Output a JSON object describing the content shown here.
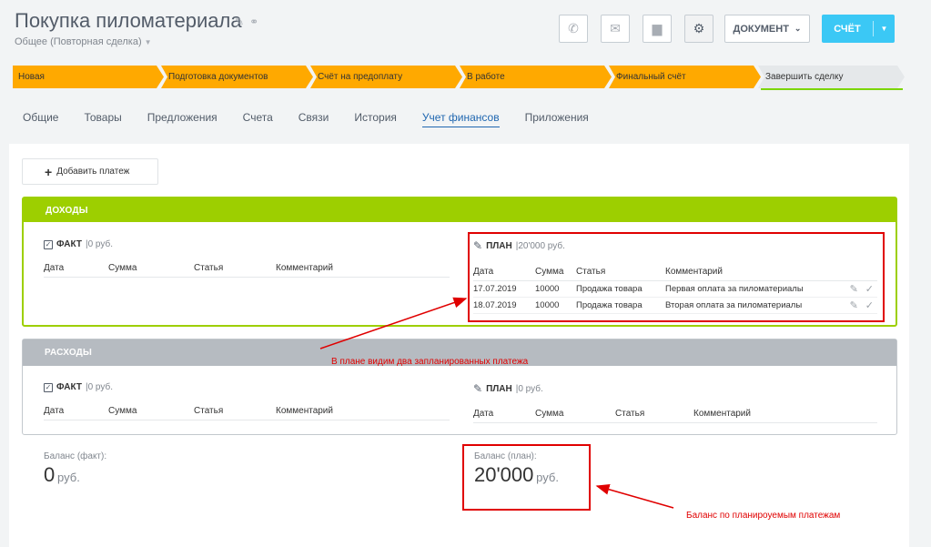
{
  "header": {
    "title": "Покупка пиломатериала",
    "subtitle": "Общее (Повторная сделка)",
    "document_label": "ДОКУМЕНТ",
    "invoice_label": "СЧЁТ"
  },
  "stages": [
    "Новая",
    "Подготовка документов",
    "Счёт на предоплату",
    "В работе",
    "Финальный счёт",
    "Завершить сделку"
  ],
  "tabs": [
    "Общие",
    "Товары",
    "Предложения",
    "Счета",
    "Связи",
    "История",
    "Учет финансов",
    "Приложения"
  ],
  "active_tab": "Учет финансов",
  "add_payment_label": "Добавить платеж",
  "income": {
    "title": "ДОХОДЫ",
    "fact": {
      "label": "ФАКТ",
      "sum": "|0 руб."
    },
    "plan": {
      "label": "ПЛАН",
      "sum": "|20'000 руб."
    },
    "fact_columns": [
      "Дата",
      "Сумма",
      "Статья",
      "Комментарий"
    ],
    "plan_columns": [
      "Дата",
      "Сумма",
      "Статья",
      "Комментарий"
    ],
    "plan_rows": [
      {
        "date": "17.07.2019",
        "amount": "10000",
        "item": "Продажа товара",
        "comment": "Первая оплата за пиломатериалы"
      },
      {
        "date": "18.07.2019",
        "amount": "10000",
        "item": "Продажа товара",
        "comment": "Вторая оплата за пиломатериалы"
      }
    ]
  },
  "expense": {
    "title": "РАСХОДЫ",
    "fact": {
      "label": "ФАКТ",
      "sum": "|0 руб."
    },
    "plan": {
      "label": "ПЛАН",
      "sum": "|0 руб."
    },
    "fact_columns": [
      "Дата",
      "Сумма",
      "Статья",
      "Комментарий"
    ],
    "plan_columns": [
      "Дата",
      "Сумма",
      "Статья",
      "Комментарий"
    ]
  },
  "balance_fact": {
    "label": "Баланс (факт):",
    "value": "0",
    "unit": "руб."
  },
  "balance_plan": {
    "label": "Баланс (план):",
    "value": "20'000",
    "unit": "руб."
  },
  "annotations": {
    "plan_note": "В плане видим два запланированных платежа",
    "balance_note": "Баланс по планироуемым платежам",
    "color": "#e00000"
  },
  "colors": {
    "accent": "#3bc8f5",
    "stage_done": "#ffa900",
    "income": "#9dcf00",
    "expense": "#b6bbc1",
    "active_tab": "#2067b0"
  }
}
